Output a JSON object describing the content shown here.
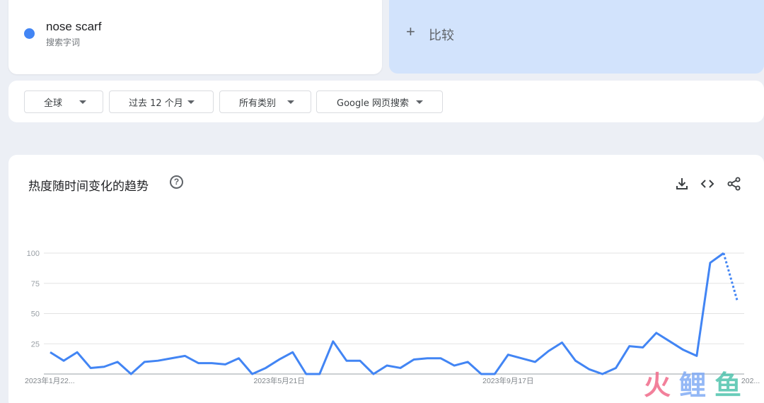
{
  "search_term": {
    "name": "nose scarf",
    "sublabel": "搜索字词",
    "color": "#4285f4"
  },
  "compare": {
    "plus": "+",
    "label": "比较"
  },
  "filters": [
    {
      "label": "全球"
    },
    {
      "label": "过去 12 个月"
    },
    {
      "label": "所有类别"
    },
    {
      "label": "Google 网页搜索"
    }
  ],
  "chart": {
    "title": "热度随时间变化的趋势",
    "help_icon": "?",
    "tools": [
      "download-icon",
      "embed-code-icon",
      "share-icon"
    ]
  },
  "watermark": {
    "text": "火鲤鱼"
  },
  "chart_data": {
    "type": "line",
    "title": "热度随时间变化的趋势",
    "ylim": [
      0,
      100
    ],
    "yticks": [
      0,
      25,
      50,
      75,
      100
    ],
    "grid": true,
    "x_tick_labels": [
      {
        "index": 0,
        "label": "2023年1月22..."
      },
      {
        "index": 17,
        "label": "2023年5月21日"
      },
      {
        "index": 34,
        "label": "2023年9月17日"
      },
      {
        "index": 52,
        "label": "202..."
      }
    ],
    "series": [
      {
        "name": "nose scarf",
        "color": "#4285f4",
        "values": [
          18,
          11,
          18,
          5,
          6,
          10,
          0,
          10,
          11,
          13,
          15,
          9,
          9,
          8,
          13,
          0,
          5,
          12,
          18,
          0,
          0,
          27,
          11,
          11,
          0,
          7,
          5,
          12,
          13,
          13,
          7,
          10,
          0,
          0,
          16,
          13,
          10,
          19,
          26,
          11,
          4,
          0,
          5,
          23,
          22,
          34,
          27,
          20,
          15,
          92,
          100,
          61
        ],
        "partial_from_index": 50
      }
    ]
  }
}
